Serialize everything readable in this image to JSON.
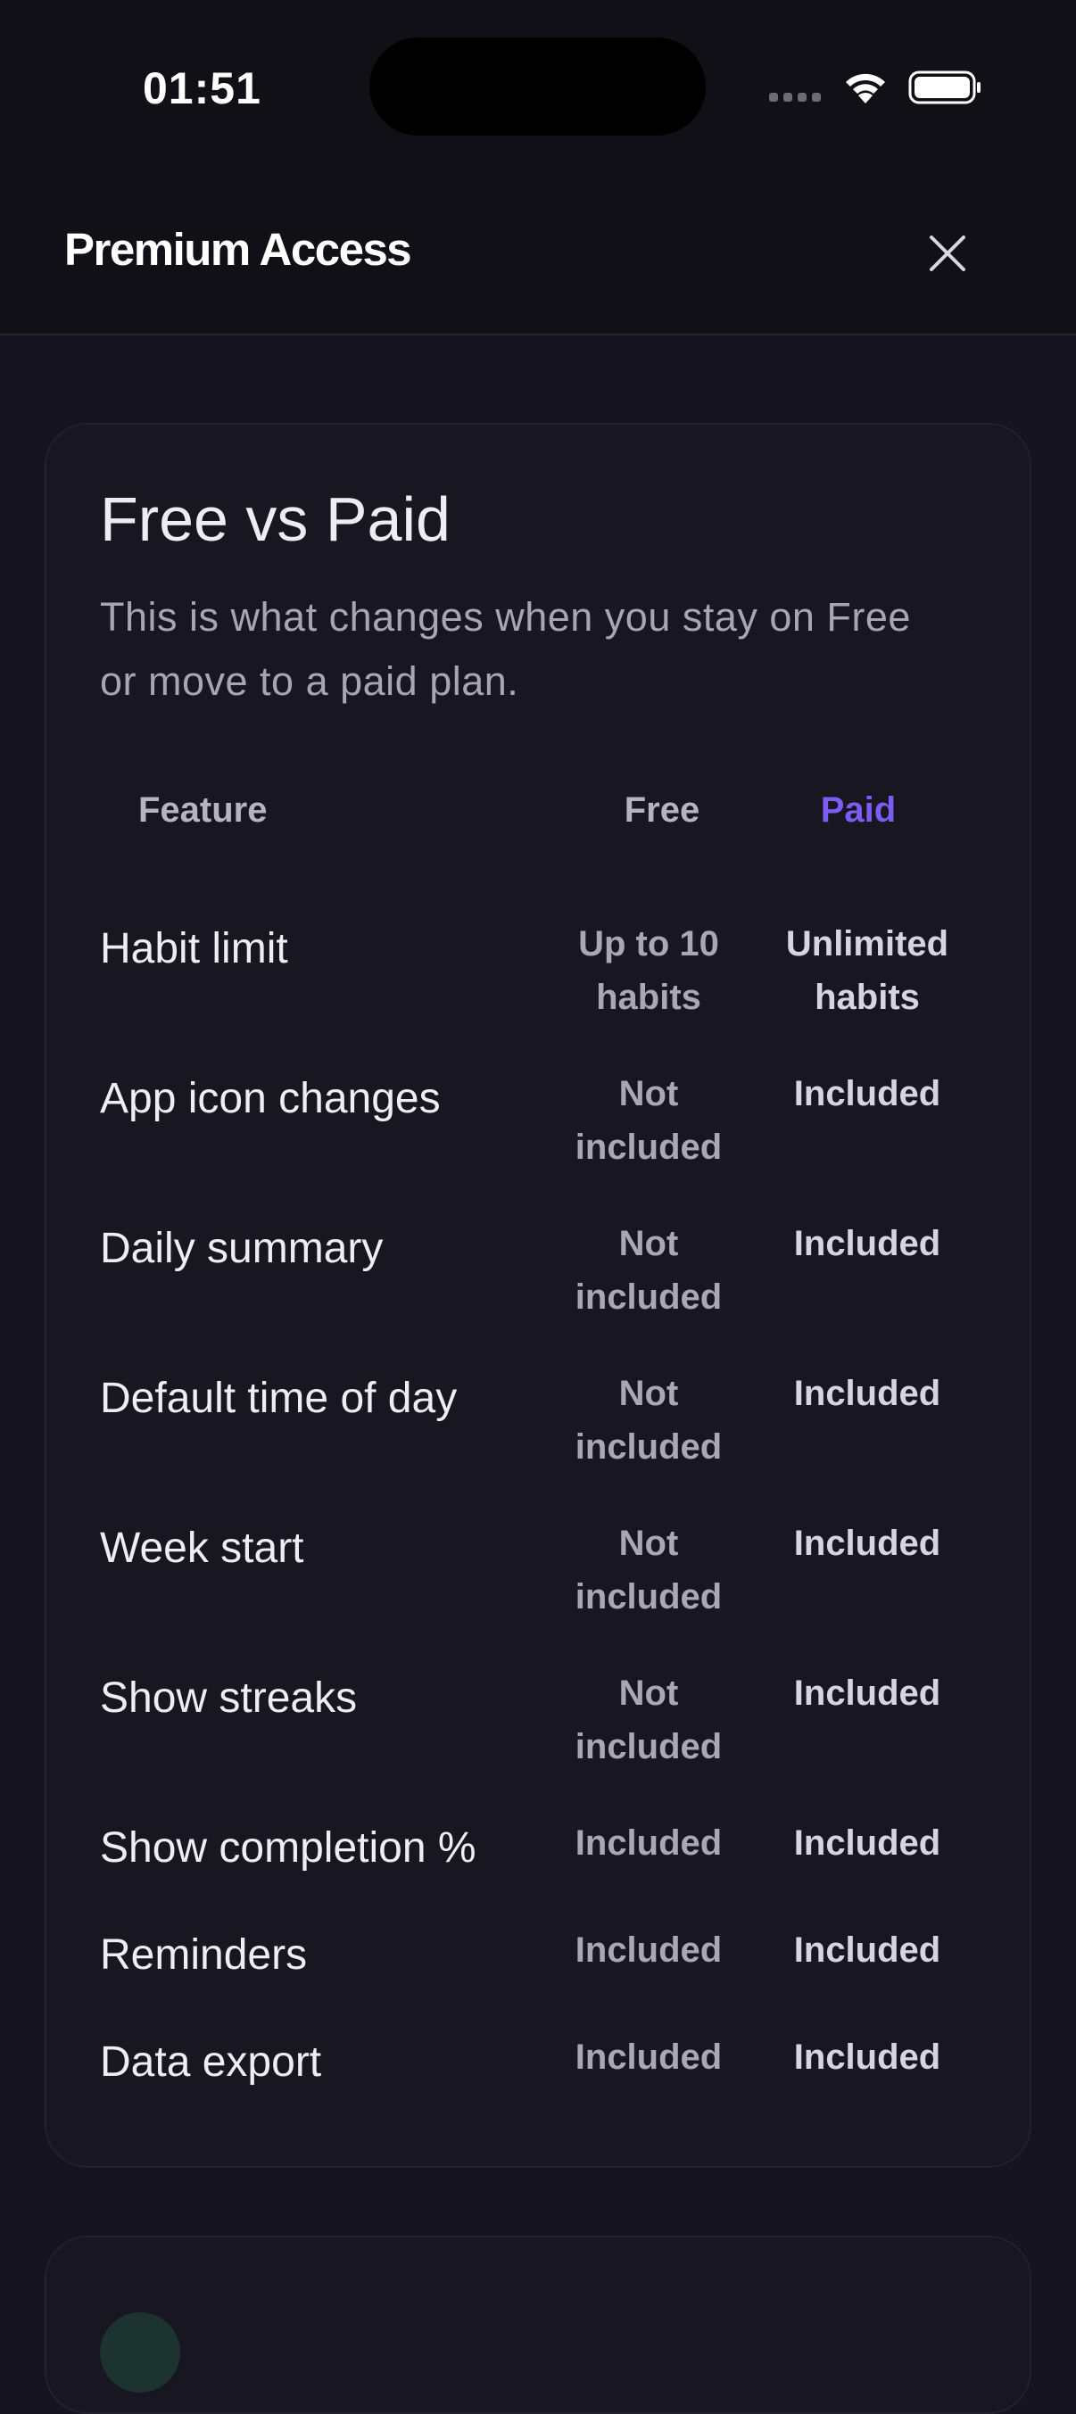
{
  "status_bar": {
    "time": "01:51"
  },
  "header": {
    "title": "Premium Access"
  },
  "comparison": {
    "title": "Free vs Paid",
    "subtitle": "This is what changes when you stay on Free or move to a paid plan.",
    "columns": {
      "feature": "Feature",
      "free": "Free",
      "paid": "Paid"
    },
    "rows": [
      {
        "feature": "Habit limit",
        "free": "Up to 10 habits",
        "paid": "Unlimited habits"
      },
      {
        "feature": "App icon changes",
        "free": "Not included",
        "paid": "Included"
      },
      {
        "feature": "Daily summary",
        "free": "Not included",
        "paid": "Included"
      },
      {
        "feature": "Default time of day",
        "free": "Not included",
        "paid": "Included"
      },
      {
        "feature": "Week start",
        "free": "Not included",
        "paid": "Included"
      },
      {
        "feature": "Show streaks",
        "free": "Not included",
        "paid": "Included"
      },
      {
        "feature": "Show completion %",
        "free": "Included",
        "paid": "Included"
      },
      {
        "feature": "Reminders",
        "free": "Included",
        "paid": "Included"
      },
      {
        "feature": "Data export",
        "free": "Included",
        "paid": "Included"
      }
    ]
  },
  "colors": {
    "accent": "#7C5CF2",
    "background": "#151420",
    "card": "#171621"
  },
  "icons": {
    "close": "close-icon",
    "wifi": "wifi-icon",
    "battery": "battery-icon"
  }
}
